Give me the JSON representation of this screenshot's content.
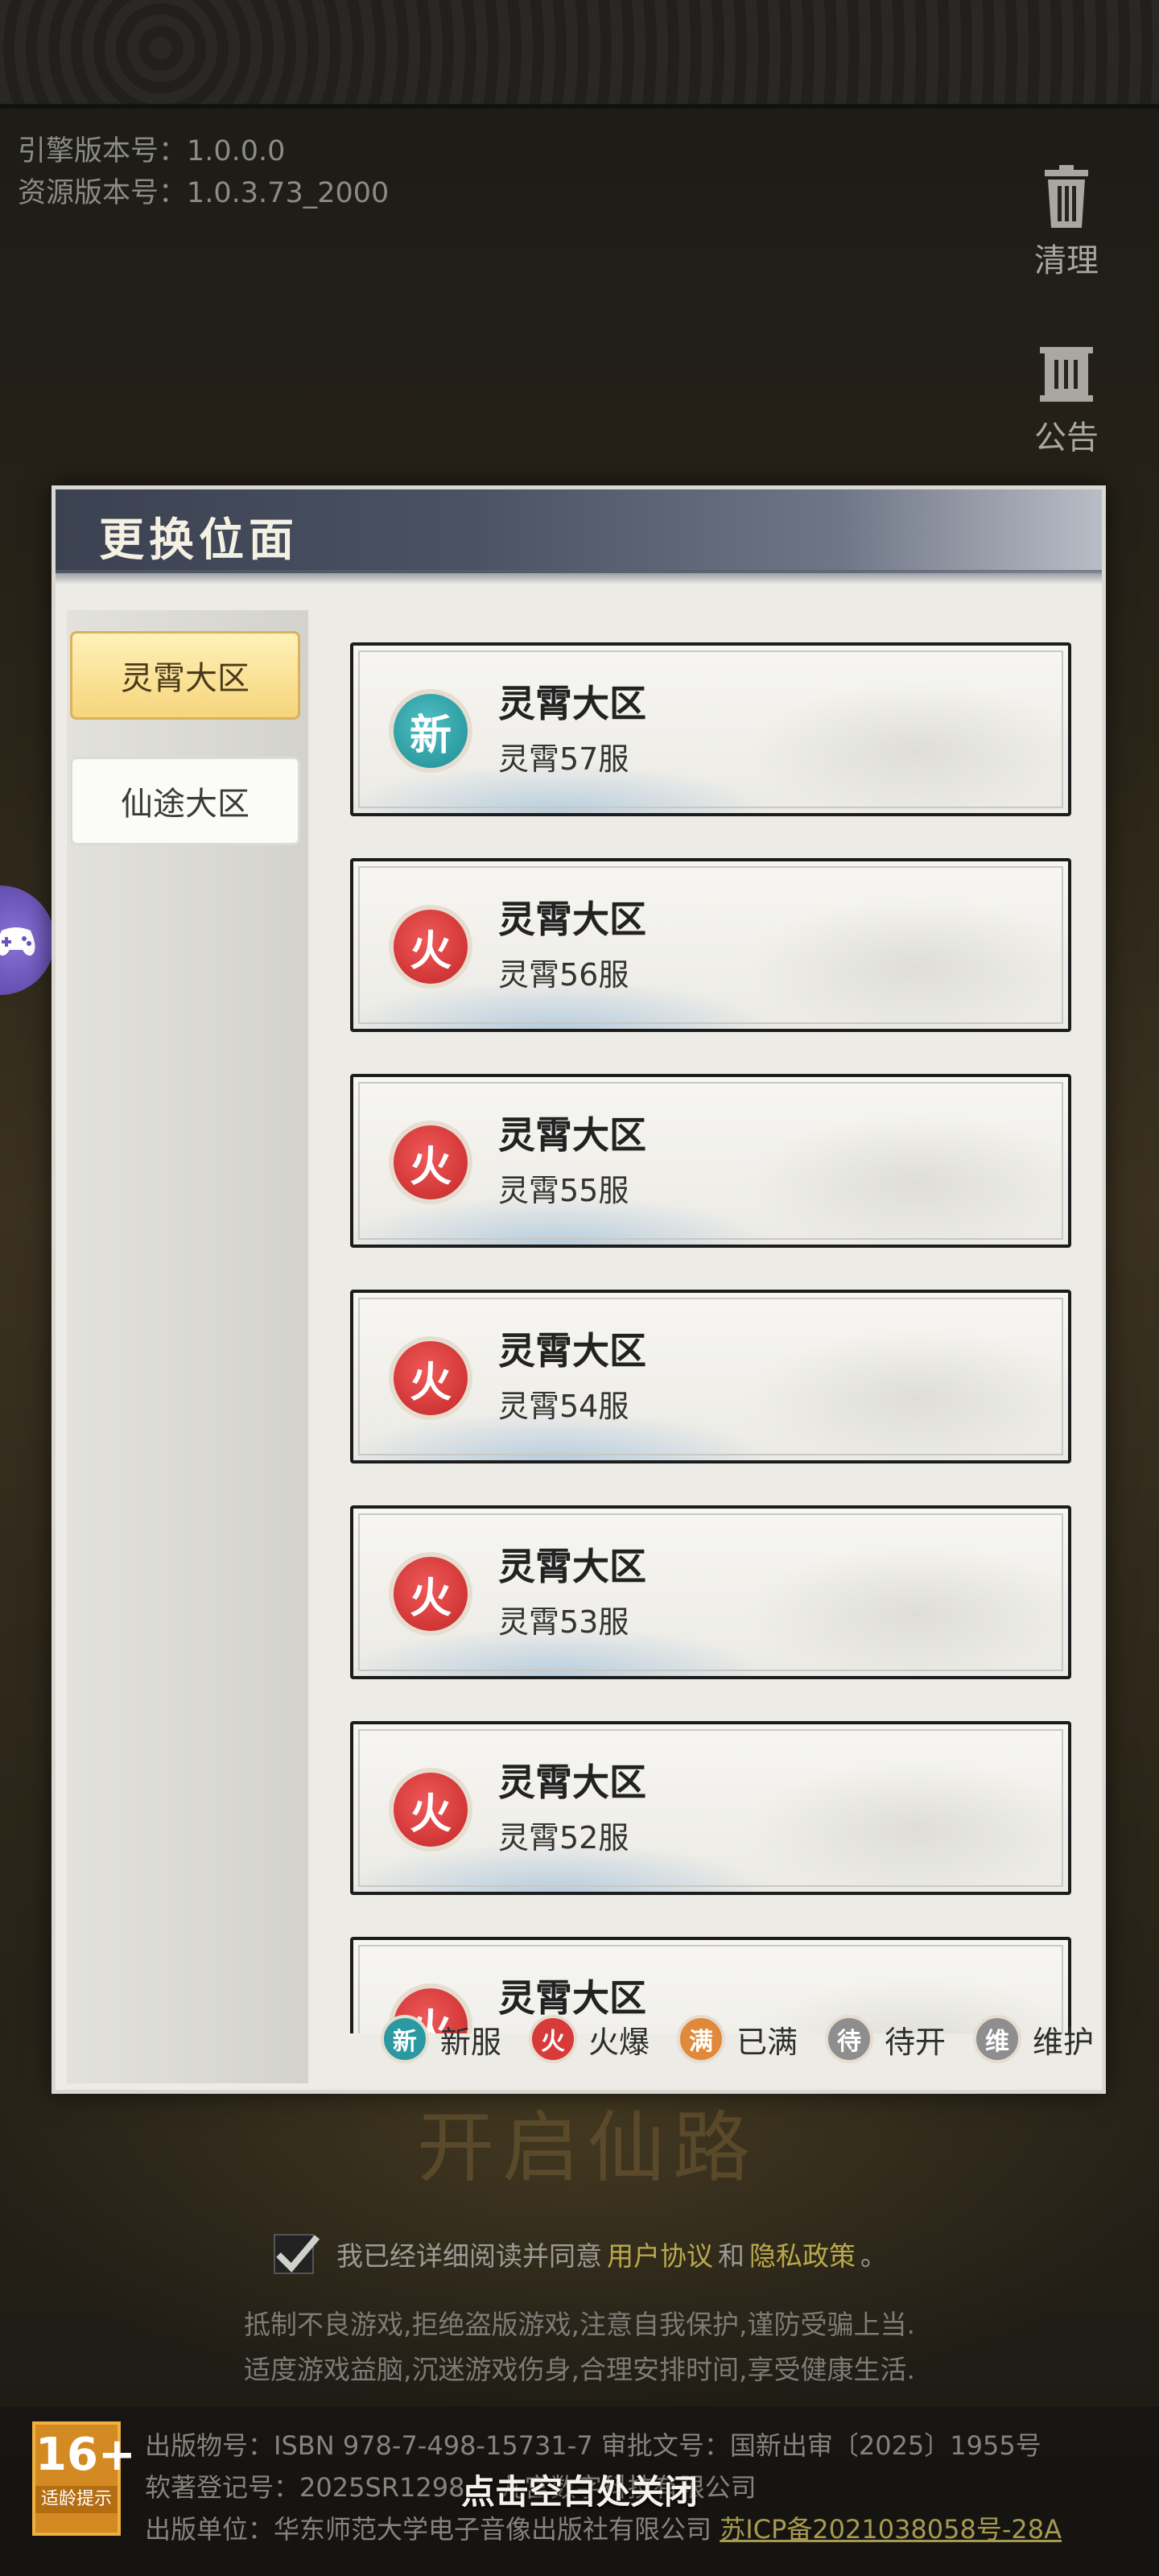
{
  "version": {
    "engine": "引擎版本号：1.0.0.0",
    "resource": "资源版本号：1.0.3.73_2000"
  },
  "side_buttons": {
    "clean_label": "清理",
    "notice_label": "公告"
  },
  "game_logo_text": "开启仙路",
  "dialog": {
    "title": "更换位面",
    "tabs": [
      {
        "label": "灵霄大区",
        "active": true
      },
      {
        "label": "仙途大区",
        "active": false
      }
    ],
    "servers": [
      {
        "region": "灵霄大区",
        "name": "灵霄57服",
        "status": "new",
        "badge": "新"
      },
      {
        "region": "灵霄大区",
        "name": "灵霄56服",
        "status": "hot",
        "badge": "火"
      },
      {
        "region": "灵霄大区",
        "name": "灵霄55服",
        "status": "hot",
        "badge": "火"
      },
      {
        "region": "灵霄大区",
        "name": "灵霄54服",
        "status": "hot",
        "badge": "火"
      },
      {
        "region": "灵霄大区",
        "name": "灵霄53服",
        "status": "hot",
        "badge": "火"
      },
      {
        "region": "灵霄大区",
        "name": "灵霄52服",
        "status": "hot",
        "badge": "火"
      },
      {
        "region": "灵霄大区",
        "name": "",
        "status": "hot",
        "badge": "火"
      }
    ],
    "legend": [
      {
        "badge": "新",
        "label": "新服",
        "color": "#2b9aa0"
      },
      {
        "badge": "火",
        "label": "火爆",
        "color": "#d83a3a"
      },
      {
        "badge": "满",
        "label": "已满",
        "color": "#e0893a"
      },
      {
        "badge": "待",
        "label": "待开",
        "color": "#8e8e8e"
      },
      {
        "badge": "维",
        "label": "维护",
        "color": "#8e8e8e"
      }
    ]
  },
  "agreement": {
    "prefix": "我已经详细阅读并同意",
    "user_agreement": "用户协议",
    "and": "和",
    "privacy_policy": "隐私政策",
    "suffix": "。"
  },
  "health_notice": [
    "抵制不良游戏,拒绝盗版游戏,注意自我保护,谨防受骗上当.",
    "适度游戏益脑,沉迷游戏伤身,合理安排时间,享受健康生活."
  ],
  "age_rating": {
    "value": "16+",
    "caption": "适龄提示"
  },
  "publish": {
    "line1": "出版物号：ISBN 978-7-498-15731-7 审批文号：国新出审〔2025〕1955号",
    "line2": "软著登记号：2025SR1298…                    九宫数字科技有限公司",
    "line3_prefix": "出版单位：华东师范大学电子音像出版社有限公司 ",
    "icp": "苏ICP备2021038058号-28A"
  },
  "close_hint": "点击空白处关闭",
  "colors": {
    "new_badge": "#2b9aa0",
    "hot_badge": "#d83a3a",
    "tab_active": "#f6d57c",
    "link": "#b9a94a"
  }
}
